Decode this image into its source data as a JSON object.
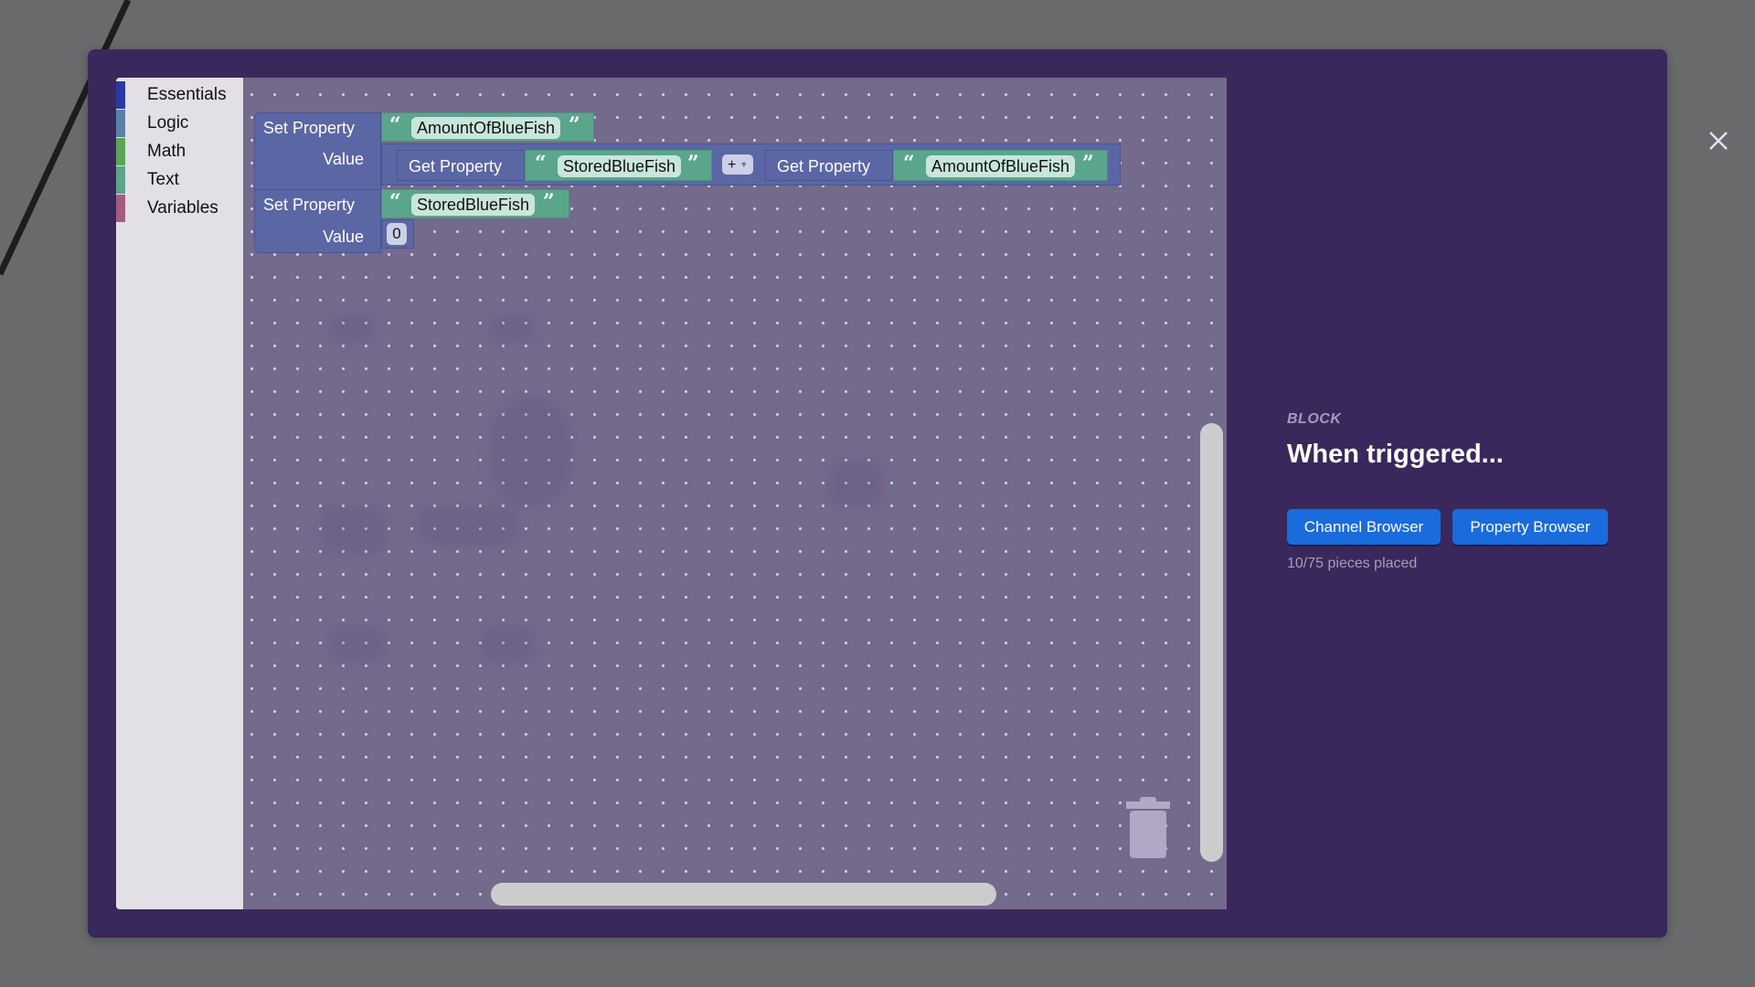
{
  "toolbox": {
    "categories": [
      {
        "label": "Essentials",
        "color": "#2a3aa0"
      },
      {
        "label": "Logic",
        "color": "#5b80a5"
      },
      {
        "label": "Math",
        "color": "#5ba55b"
      },
      {
        "label": "Text",
        "color": "#5ba58c"
      },
      {
        "label": "Variables",
        "color": "#a55b80"
      }
    ]
  },
  "blocks": {
    "set1": {
      "label": "Set Property",
      "property": "AmountOfBlueFish",
      "value_label": "Value",
      "value": {
        "get1": {
          "label": "Get Property",
          "property": "StoredBlueFish"
        },
        "operator": "+",
        "get2": {
          "label": "Get Property",
          "property": "AmountOfBlueFish"
        }
      }
    },
    "set2": {
      "label": "Set Property",
      "property": "StoredBlueFish",
      "value_label": "Value",
      "value": "0"
    },
    "quote_open": "“",
    "quote_close": "”"
  },
  "panel": {
    "label": "BLOCK",
    "title": "When triggered...",
    "buttons": {
      "channel_browser": "Channel Browser",
      "property_browser": "Property Browser"
    },
    "status": "10/75 pieces placed"
  },
  "colors": {
    "modal": "#3a285d",
    "block_blue": "#5b67a5",
    "block_green": "#5ba58c",
    "button": "#1a6bdc"
  }
}
